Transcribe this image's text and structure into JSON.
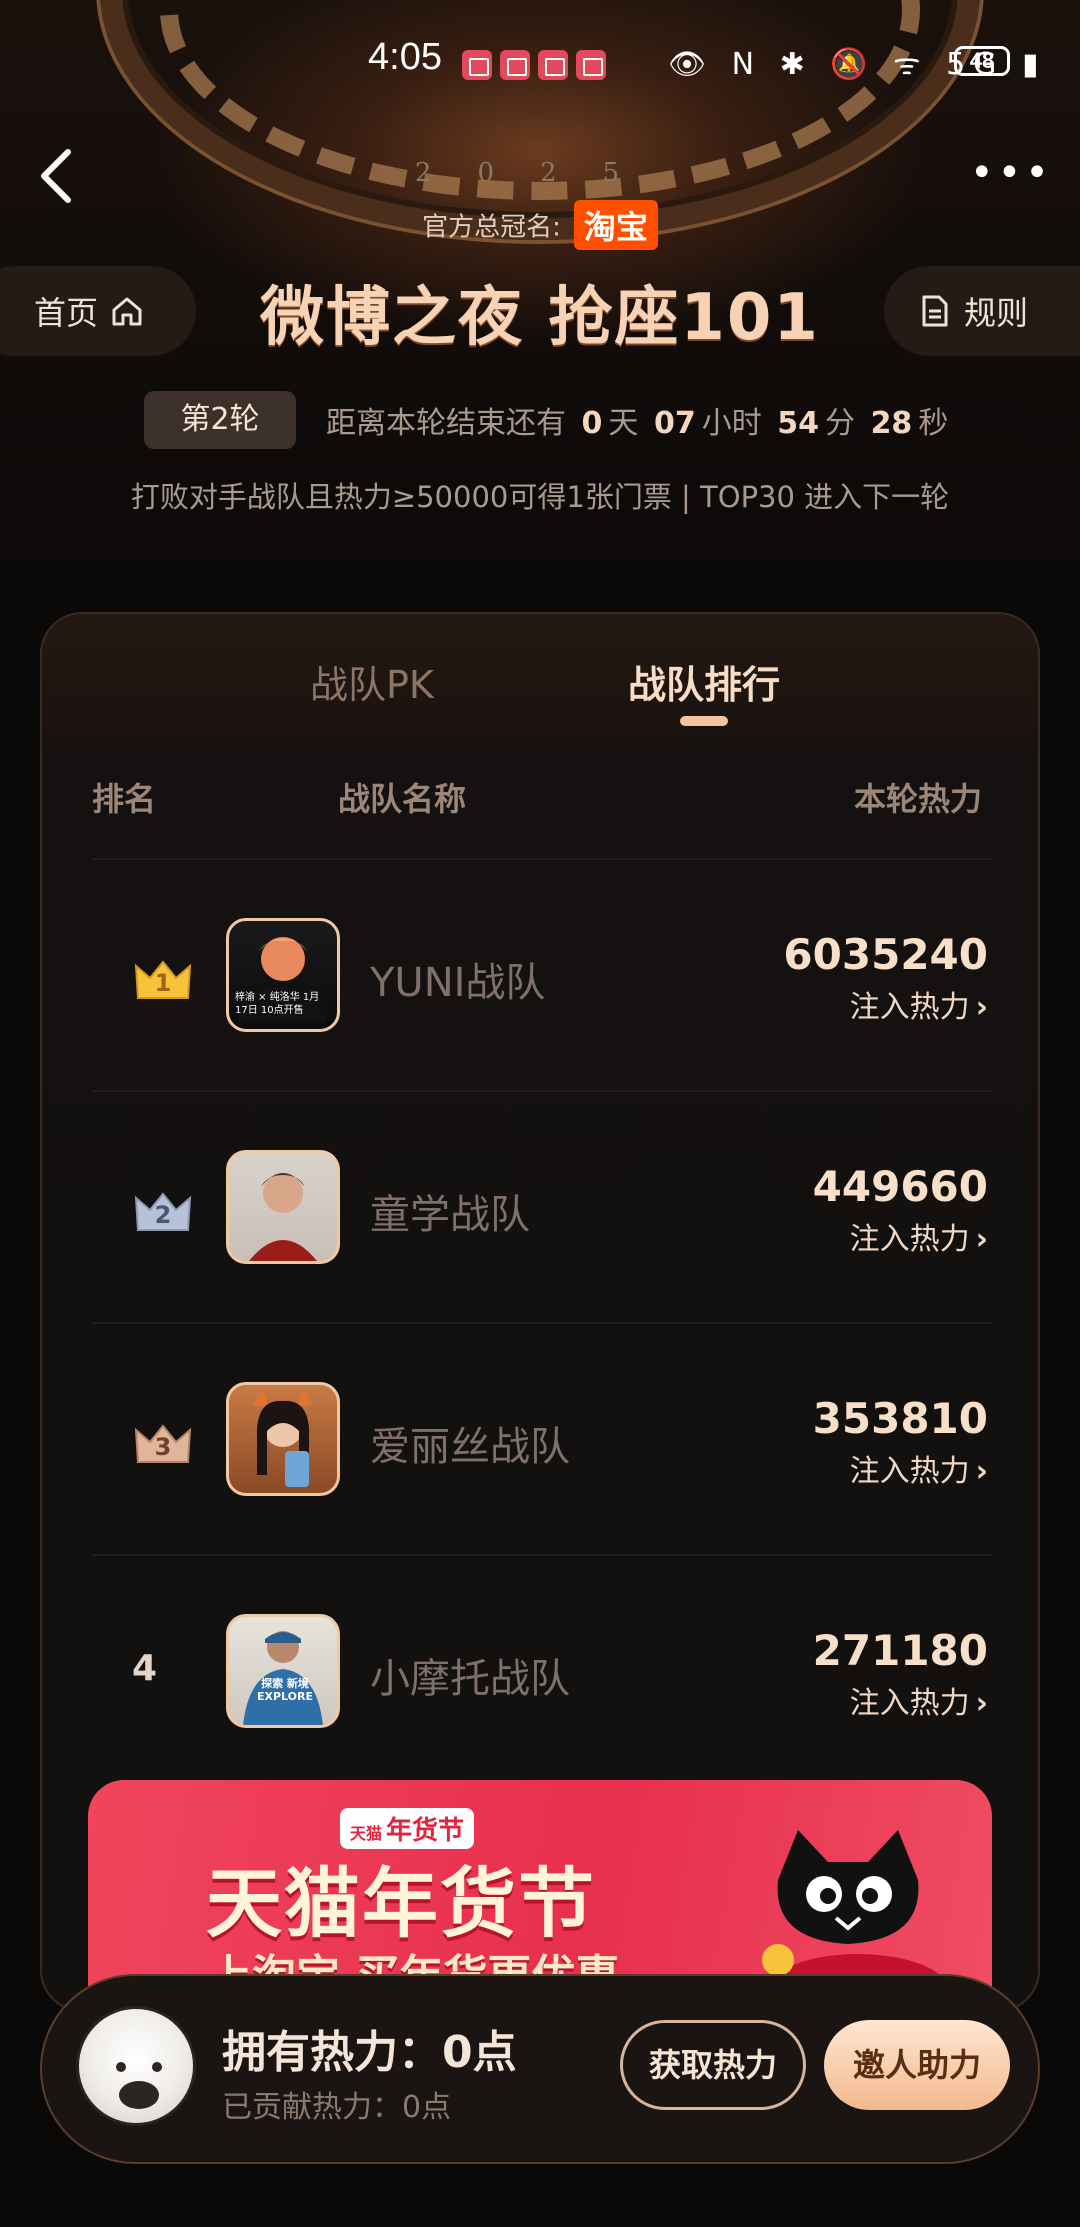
{
  "status_bar": {
    "time": "4:05",
    "icons_text": "👁 N ✱ 🔕 ᯤ 5G ▮",
    "battery": "48"
  },
  "header": {
    "year_text": "2025",
    "sponsor_label": "官方总冠名:",
    "sponsor_brand": "淘宝",
    "home_label": "首页",
    "rules_label": "规则",
    "title": "微博之夜 抢座101",
    "round_badge": "第2轮",
    "countdown": {
      "prefix": "距离本轮结束还有",
      "days": "0",
      "days_unit": "天",
      "hours": "07",
      "hours_unit": "小时",
      "minutes": "54",
      "minutes_unit": "分",
      "seconds": "28",
      "seconds_unit": "秒"
    },
    "rule_line": "打败对手战队且热力≥50000可得1张门票 | TOP30 进入下一轮"
  },
  "tabs": {
    "pk": "战队PK",
    "rank": "战队排行"
  },
  "table": {
    "headers": {
      "rank": "排名",
      "name": "战队名称",
      "heat": "本轮热力"
    },
    "rows": [
      {
        "rank": "1",
        "name": "YUNI战队",
        "heat": "6035240",
        "action": "注入热力",
        "crown_color": "#f6c33a",
        "avatar_caption": "梓渝 × 纯洛华 1月17日 10点开售"
      },
      {
        "rank": "2",
        "name": "童学战队",
        "heat": "449660",
        "action": "注入热力",
        "crown_color": "#b7c2d8"
      },
      {
        "rank": "3",
        "name": "爱丽丝战队",
        "heat": "353810",
        "action": "注入热力",
        "crown_color": "#e0b59a"
      },
      {
        "rank": "4",
        "name": "小摩托战队",
        "heat": "271180",
        "action": "注入热力",
        "avatar_caption": "探索 新境 EXPLORE"
      }
    ]
  },
  "banner": {
    "tag": "年货节",
    "tag_brand": "天猫",
    "title": "天猫年货节",
    "subtitle": "上淘宝 买年货更优惠"
  },
  "footer": {
    "own_heat": "拥有热力：0点",
    "contributed": "已贡献热力：0点",
    "get_button": "获取热力",
    "invite_button": "邀人助力"
  }
}
